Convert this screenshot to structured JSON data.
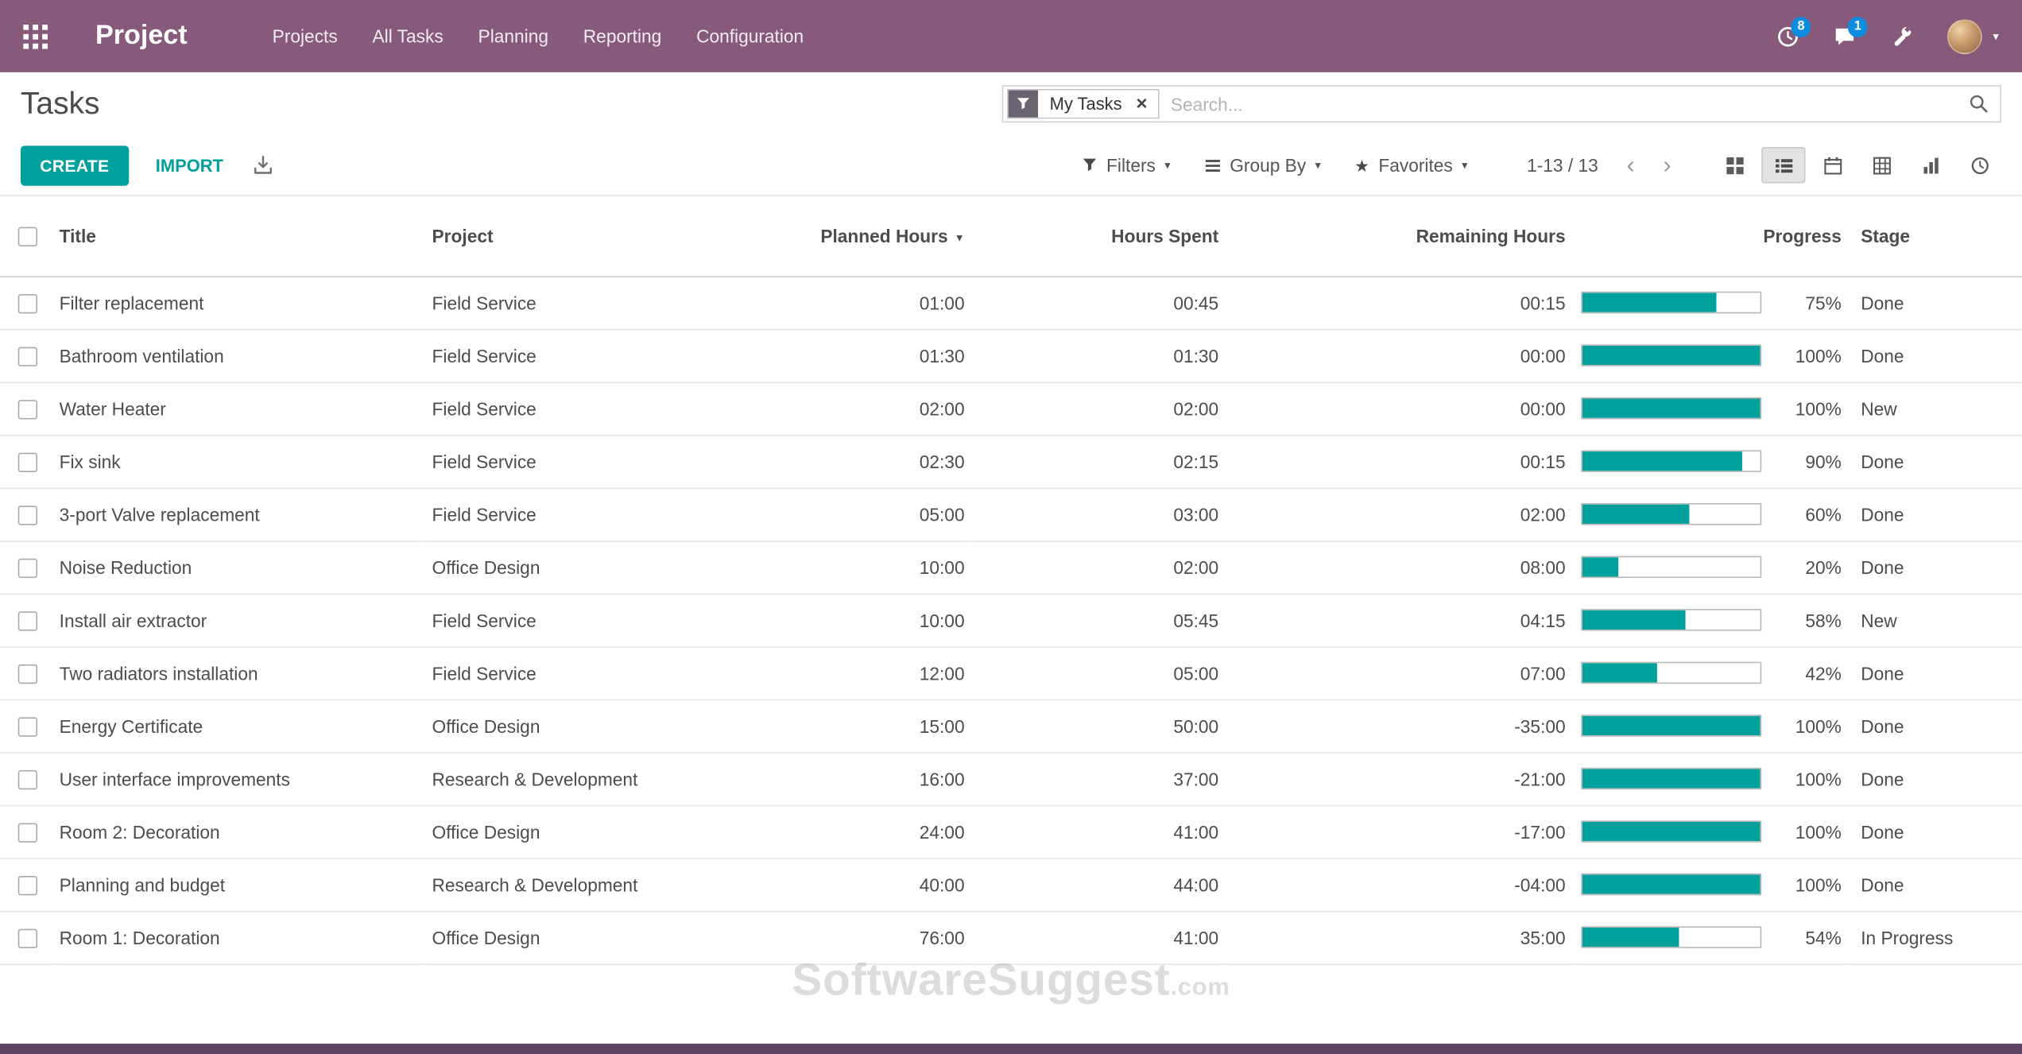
{
  "colors": {
    "navbar_bg": "#875A7B",
    "accent": "#00A09D",
    "badge_blue": "#0c8de0",
    "footer_strip": "#5e4463"
  },
  "navbar": {
    "app_title": "Project",
    "menu": [
      "Projects",
      "All Tasks",
      "Planning",
      "Reporting",
      "Configuration"
    ],
    "activity_badge": "8",
    "message_badge": "1"
  },
  "control_panel": {
    "title": "Tasks",
    "search": {
      "facet_label": "My Tasks",
      "placeholder": "Search..."
    },
    "create_label": "CREATE",
    "import_label": "IMPORT",
    "filters_label": "Filters",
    "group_by_label": "Group By",
    "favorites_label": "Favorites",
    "pager_value": "1-13 / 13",
    "views": [
      "kanban",
      "list",
      "calendar",
      "pivot",
      "graph",
      "activity"
    ],
    "active_view": "list"
  },
  "icons": {
    "caret_down": "▾",
    "sort_desc": "▼",
    "star": "★",
    "chevron_left": "‹",
    "chevron_right": "›",
    "facet_remove": "×"
  },
  "table": {
    "headers": {
      "title": "Title",
      "project": "Project",
      "planned": "Planned Hours",
      "spent": "Hours Spent",
      "remaining": "Remaining Hours",
      "progress": "Progress",
      "stage": "Stage"
    },
    "rows": [
      {
        "title": "Filter replacement",
        "project": "Field Service",
        "planned": "01:00",
        "spent": "00:45",
        "remaining": "00:15",
        "progress_pct": 75,
        "progress_label": "75%",
        "stage": "Done"
      },
      {
        "title": "Bathroom ventilation",
        "project": "Field Service",
        "planned": "01:30",
        "spent": "01:30",
        "remaining": "00:00",
        "progress_pct": 100,
        "progress_label": "100%",
        "stage": "Done"
      },
      {
        "title": "Water Heater",
        "project": "Field Service",
        "planned": "02:00",
        "spent": "02:00",
        "remaining": "00:00",
        "progress_pct": 100,
        "progress_label": "100%",
        "stage": "New"
      },
      {
        "title": "Fix sink",
        "project": "Field Service",
        "planned": "02:30",
        "spent": "02:15",
        "remaining": "00:15",
        "progress_pct": 90,
        "progress_label": "90%",
        "stage": "Done"
      },
      {
        "title": "3-port Valve replacement",
        "project": "Field Service",
        "planned": "05:00",
        "spent": "03:00",
        "remaining": "02:00",
        "progress_pct": 60,
        "progress_label": "60%",
        "stage": "Done"
      },
      {
        "title": "Noise Reduction",
        "project": "Office Design",
        "planned": "10:00",
        "spent": "02:00",
        "remaining": "08:00",
        "progress_pct": 20,
        "progress_label": "20%",
        "stage": "Done"
      },
      {
        "title": "Install air extractor",
        "project": "Field Service",
        "planned": "10:00",
        "spent": "05:45",
        "remaining": "04:15",
        "progress_pct": 58,
        "progress_label": "58%",
        "stage": "New"
      },
      {
        "title": "Two radiators installation",
        "project": "Field Service",
        "planned": "12:00",
        "spent": "05:00",
        "remaining": "07:00",
        "progress_pct": 42,
        "progress_label": "42%",
        "stage": "Done"
      },
      {
        "title": "Energy Certificate",
        "project": "Office Design",
        "planned": "15:00",
        "spent": "50:00",
        "remaining": "-35:00",
        "progress_pct": 100,
        "progress_label": "100%",
        "stage": "Done"
      },
      {
        "title": "User interface improvements",
        "project": "Research & Development",
        "planned": "16:00",
        "spent": "37:00",
        "remaining": "-21:00",
        "progress_pct": 100,
        "progress_label": "100%",
        "stage": "Done"
      },
      {
        "title": "Room 2: Decoration",
        "project": "Office Design",
        "planned": "24:00",
        "spent": "41:00",
        "remaining": "-17:00",
        "progress_pct": 100,
        "progress_label": "100%",
        "stage": "Done"
      },
      {
        "title": "Planning and budget",
        "project": "Research & Development",
        "planned": "40:00",
        "spent": "44:00",
        "remaining": "-04:00",
        "progress_pct": 100,
        "progress_label": "100%",
        "stage": "Done"
      },
      {
        "title": "Room 1: Decoration",
        "project": "Office Design",
        "planned": "76:00",
        "spent": "41:00",
        "remaining": "35:00",
        "progress_pct": 54,
        "progress_label": "54%",
        "stage": "In Progress"
      }
    ]
  },
  "watermark": {
    "text": "SoftwareSuggest",
    "suffix": ".com"
  }
}
